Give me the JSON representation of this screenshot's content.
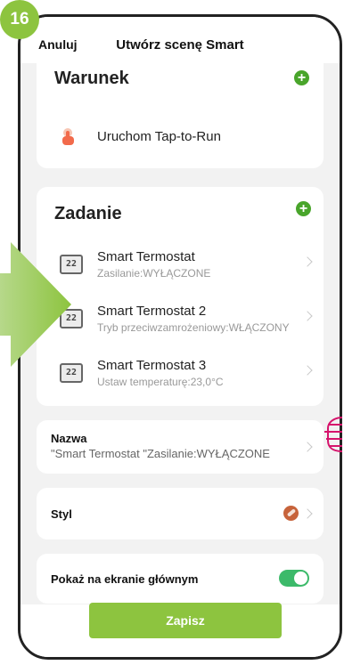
{
  "step_badge": "16",
  "header": {
    "cancel_label": "Anuluj",
    "title": "Utwórz scenę Smart"
  },
  "conditions": {
    "title": "Warunek",
    "item_label": "Uruchom Tap-to-Run"
  },
  "tasks": {
    "title": "Zadanie",
    "items": [
      {
        "icon_text": "22",
        "name": "Smart Termostat",
        "detail": "Zasilanie:WYŁĄCZONE"
      },
      {
        "icon_text": "22",
        "name": "Smart Termostat 2",
        "detail": "Tryb przeciwzamrożeniowy:WŁĄCZONY"
      },
      {
        "icon_text": "22",
        "name": "Smart Termostat 3",
        "detail": "Ustaw temperaturę:23,0°C"
      }
    ]
  },
  "name_row": {
    "label": "Nazwa",
    "value": "\"Smart Termostat \"Zasilanie:WYŁĄCZONE"
  },
  "style_row": {
    "label": "Styl"
  },
  "home_row": {
    "label": "Pokaż na ekranie głównym",
    "toggle_on": true
  },
  "save_label": "Zapisz",
  "colors": {
    "accent_green": "#8dc43f",
    "plus_green": "#49a52b",
    "toggle_green": "#3cba6a",
    "style_color": "#c7633b",
    "annotation_pink": "#d6136c"
  }
}
